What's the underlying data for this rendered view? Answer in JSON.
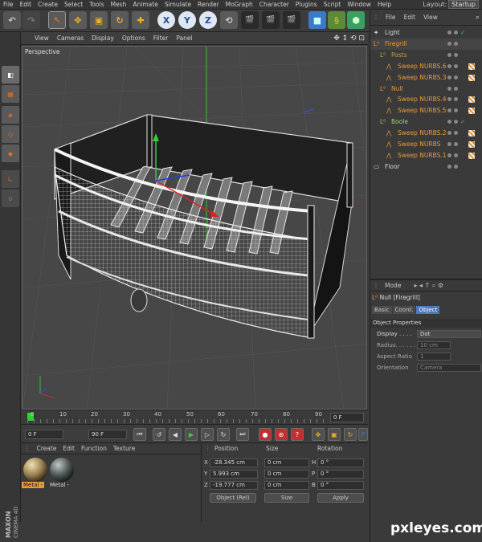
{
  "menubar": {
    "items": [
      "File",
      "Edit",
      "Create",
      "Select",
      "Tools",
      "Mesh",
      "Animate",
      "Simulate",
      "Render",
      "MoGraph",
      "Character",
      "Plugins",
      "Script",
      "Window",
      "Help"
    ],
    "layout_label": "Layout:",
    "layout_value": "Startup"
  },
  "toolbar": {
    "axis_x": "X",
    "axis_y": "Y",
    "axis_z": "Z"
  },
  "viewport": {
    "menu": [
      "View",
      "Cameras",
      "Display",
      "Options",
      "Filter",
      "Panel"
    ],
    "label": "Perspective"
  },
  "timeline": {
    "ticks": [
      "0",
      "10",
      "20",
      "30",
      "40",
      "50",
      "60",
      "70",
      "80",
      "90"
    ],
    "frame_field": "0 F"
  },
  "transport": {
    "start": "0 F",
    "end": "90 F"
  },
  "materials": {
    "menu": [
      "Create",
      "Edit",
      "Function",
      "Texture"
    ],
    "items": [
      {
        "label": "Metal -"
      },
      {
        "label": "Metal -"
      }
    ]
  },
  "coords": {
    "headers": {
      "position": "Position",
      "size": "Size",
      "rotation": "Rotation"
    },
    "rows": [
      {
        "axis": "X",
        "pos": "-28.345 cm",
        "size": "0 cm",
        "rot_axis": "H",
        "rot": "0 °"
      },
      {
        "axis": "Y",
        "pos": "5.993 cm",
        "size": "0 cm",
        "rot_axis": "P",
        "rot": "0 °"
      },
      {
        "axis": "Z",
        "pos": "-19.777 cm",
        "size": "0 cm",
        "rot_axis": "B",
        "rot": "0 °"
      }
    ],
    "mode": "Object (Rel)",
    "size_mode": "Size",
    "apply": "Apply"
  },
  "objects": {
    "menu": [
      "File",
      "Edit",
      "View"
    ],
    "rows": [
      {
        "name": "Light",
        "indent": 0,
        "color": "#d8d8d8",
        "tag": false,
        "check": true
      },
      {
        "name": "Firegrill",
        "indent": 0,
        "color": "#e89a3a",
        "tag": false,
        "check": false
      },
      {
        "name": "Posts",
        "indent": 1,
        "color": "#c8a040",
        "tag": false,
        "check": false
      },
      {
        "name": "Sweep NURBS.6",
        "indent": 2,
        "color": "#e89a3a",
        "tag": true,
        "check": false
      },
      {
        "name": "Sweep NURBS.3",
        "indent": 2,
        "color": "#e89a3a",
        "tag": true,
        "check": false
      },
      {
        "name": "Null",
        "indent": 1,
        "color": "#e89a3a",
        "tag": false,
        "check": false
      },
      {
        "name": "Sweep NURBS.4",
        "indent": 2,
        "color": "#e89a3a",
        "tag": true,
        "check": false
      },
      {
        "name": "Sweep NURBS.5",
        "indent": 2,
        "color": "#e89a3a",
        "tag": true,
        "check": false
      },
      {
        "name": "Boole",
        "indent": 1,
        "color": "#a8d060",
        "tag": false,
        "check": true
      },
      {
        "name": "Sweep NURBS.2",
        "indent": 2,
        "color": "#e89a3a",
        "tag": true,
        "check": false
      },
      {
        "name": "Sweep NURBS",
        "indent": 2,
        "color": "#e89a3a",
        "tag": true,
        "check": false
      },
      {
        "name": "Sweep NURBS.1",
        "indent": 2,
        "color": "#e89a3a",
        "tag": true,
        "check": false
      },
      {
        "name": "Floor",
        "indent": 0,
        "color": "#d8d8d8",
        "tag": false,
        "check": false
      }
    ]
  },
  "attributes": {
    "mode": "Mode",
    "object_title": "Null [Firegrill]",
    "tabs": [
      "Basic",
      "Coord.",
      "Object"
    ],
    "section": "Object Properties",
    "props": [
      {
        "label": "Display . . . .",
        "value": "Dot"
      },
      {
        "label": "Radius. . . . . .",
        "value": "10 cm"
      },
      {
        "label": "Aspect Ratio",
        "value": "1"
      },
      {
        "label": "Orientation",
        "value": "Camera"
      }
    ]
  },
  "branding": {
    "maxon": "MAXON",
    "product": "CINEMA 4D"
  },
  "watermark": "pxleyes.com"
}
